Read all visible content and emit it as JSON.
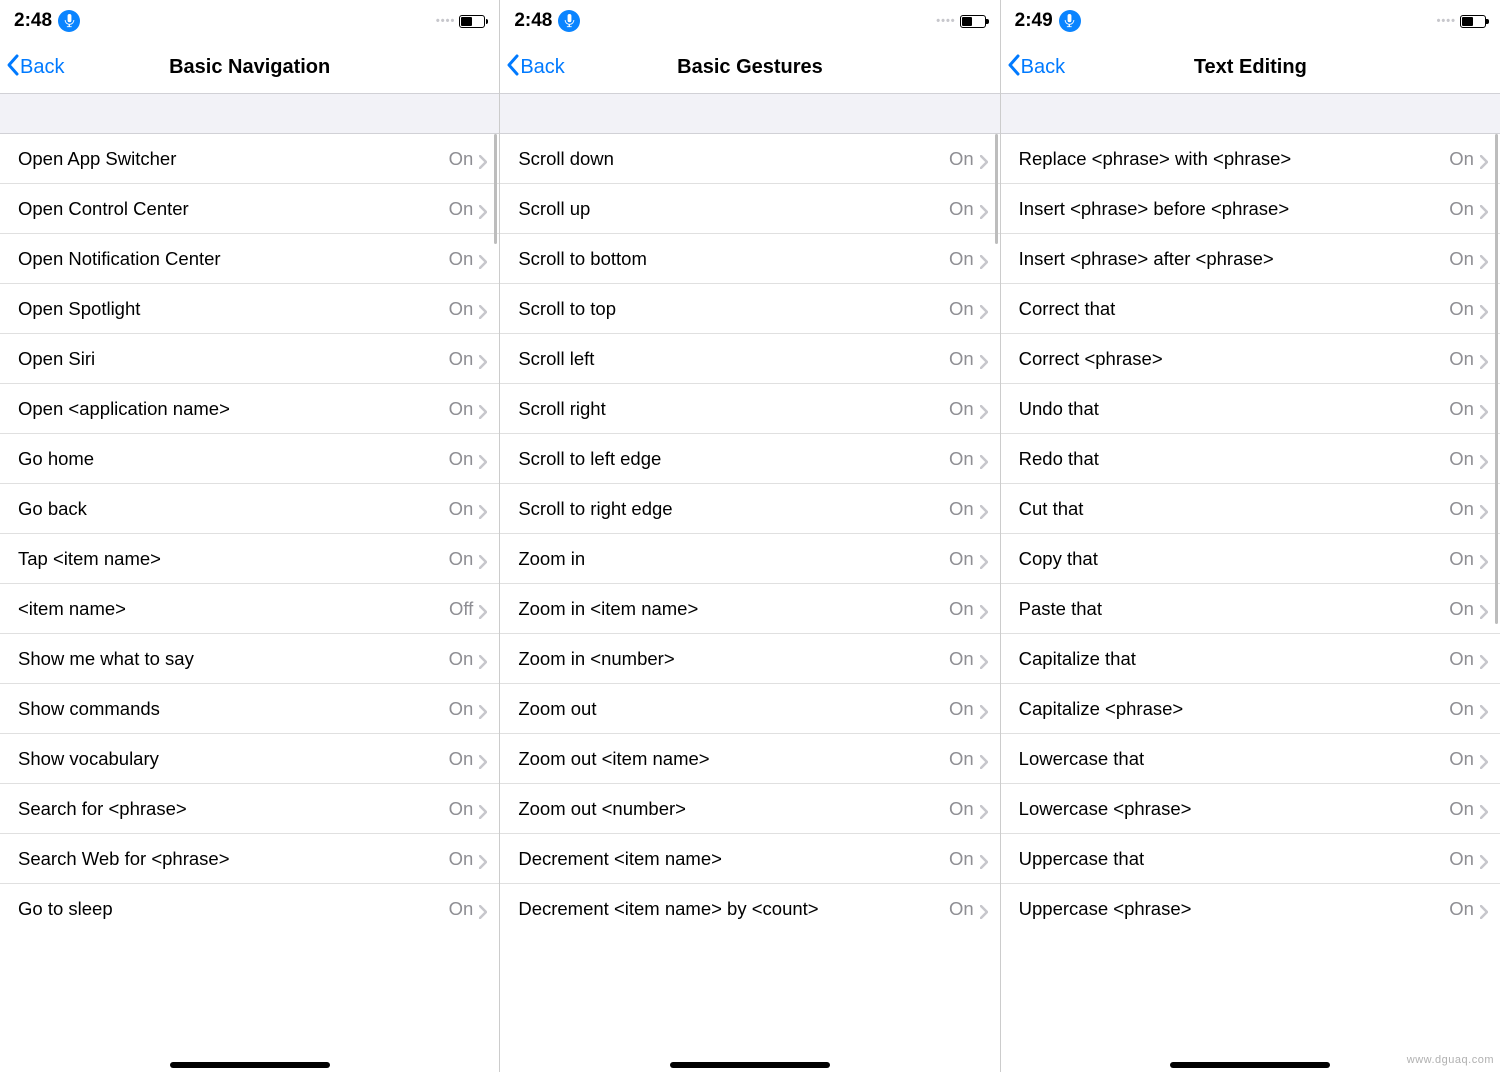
{
  "screens": [
    {
      "time": "2:48",
      "back": "Back",
      "title": "Basic Navigation",
      "items": [
        {
          "label": "Open App Switcher",
          "value": "On"
        },
        {
          "label": "Open Control Center",
          "value": "On"
        },
        {
          "label": "Open Notification Center",
          "value": "On"
        },
        {
          "label": "Open Spotlight",
          "value": "On"
        },
        {
          "label": "Open Siri",
          "value": "On"
        },
        {
          "label": "Open <application name>",
          "value": "On"
        },
        {
          "label": "Go home",
          "value": "On"
        },
        {
          "label": "Go back",
          "value": "On"
        },
        {
          "label": "Tap <item name>",
          "value": "On"
        },
        {
          "label": "<item name>",
          "value": "Off"
        },
        {
          "label": "Show me what to say",
          "value": "On"
        },
        {
          "label": "Show commands",
          "value": "On"
        },
        {
          "label": "Show vocabulary",
          "value": "On"
        },
        {
          "label": "Search for <phrase>",
          "value": "On"
        },
        {
          "label": "Search Web for <phrase>",
          "value": "On"
        },
        {
          "label": "Go to sleep",
          "value": "On"
        }
      ]
    },
    {
      "time": "2:48",
      "back": "Back",
      "title": "Basic Gestures",
      "items": [
        {
          "label": "Scroll down",
          "value": "On"
        },
        {
          "label": "Scroll up",
          "value": "On"
        },
        {
          "label": "Scroll to bottom",
          "value": "On"
        },
        {
          "label": "Scroll to top",
          "value": "On"
        },
        {
          "label": "Scroll left",
          "value": "On"
        },
        {
          "label": "Scroll right",
          "value": "On"
        },
        {
          "label": "Scroll to left edge",
          "value": "On"
        },
        {
          "label": "Scroll to right edge",
          "value": "On"
        },
        {
          "label": "Zoom in",
          "value": "On"
        },
        {
          "label": "Zoom in <item name>",
          "value": "On"
        },
        {
          "label": "Zoom in <number>",
          "value": "On"
        },
        {
          "label": "Zoom out",
          "value": "On"
        },
        {
          "label": "Zoom out <item name>",
          "value": "On"
        },
        {
          "label": "Zoom out <number>",
          "value": "On"
        },
        {
          "label": "Decrement <item name>",
          "value": "On"
        },
        {
          "label": "Decrement <item name> by <count>",
          "value": "On"
        }
      ]
    },
    {
      "time": "2:49",
      "back": "Back",
      "title": "Text Editing",
      "items": [
        {
          "label": "Replace <phrase> with <phrase>",
          "value": "On"
        },
        {
          "label": "Insert <phrase> before <phrase>",
          "value": "On"
        },
        {
          "label": "Insert <phrase> after <phrase>",
          "value": "On"
        },
        {
          "label": "Correct that",
          "value": "On"
        },
        {
          "label": "Correct <phrase>",
          "value": "On"
        },
        {
          "label": "Undo that",
          "value": "On"
        },
        {
          "label": "Redo that",
          "value": "On"
        },
        {
          "label": "Cut that",
          "value": "On"
        },
        {
          "label": "Copy that",
          "value": "On"
        },
        {
          "label": "Paste that",
          "value": "On"
        },
        {
          "label": "Capitalize that",
          "value": "On"
        },
        {
          "label": "Capitalize <phrase>",
          "value": "On"
        },
        {
          "label": "Lowercase that",
          "value": "On"
        },
        {
          "label": "Lowercase <phrase>",
          "value": "On"
        },
        {
          "label": "Uppercase that",
          "value": "On"
        },
        {
          "label": "Uppercase <phrase>",
          "value": "On"
        }
      ]
    }
  ],
  "watermark": "www.dguaq.com"
}
